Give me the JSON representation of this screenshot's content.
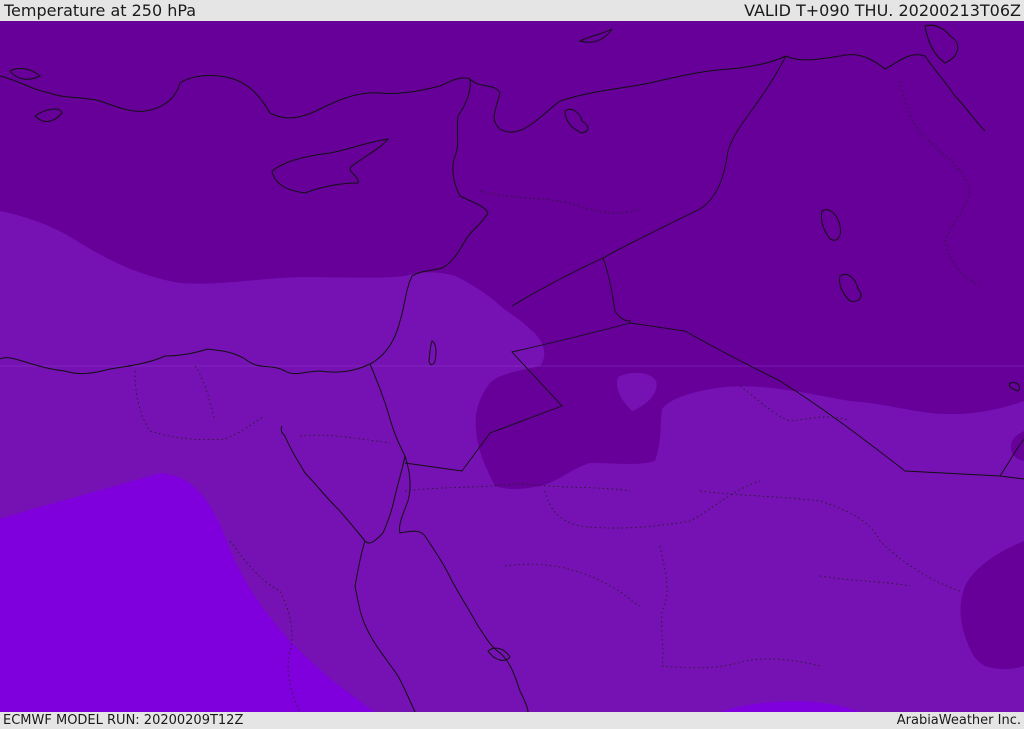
{
  "header": {
    "title": "Temperature at 250 hPa",
    "valid": "VALID T+090 THU. 20200213T06Z"
  },
  "footer": {
    "model_run": "ECMWF MODEL RUN: 20200209T12Z",
    "credit": "ArabiaWeather Inc."
  },
  "colors": {
    "coldest_band": "#660099",
    "mid_band": "#7611b4",
    "warm_band": "#8000dd",
    "land_lines": "#111111",
    "bar_background": "#e5e5e5"
  }
}
